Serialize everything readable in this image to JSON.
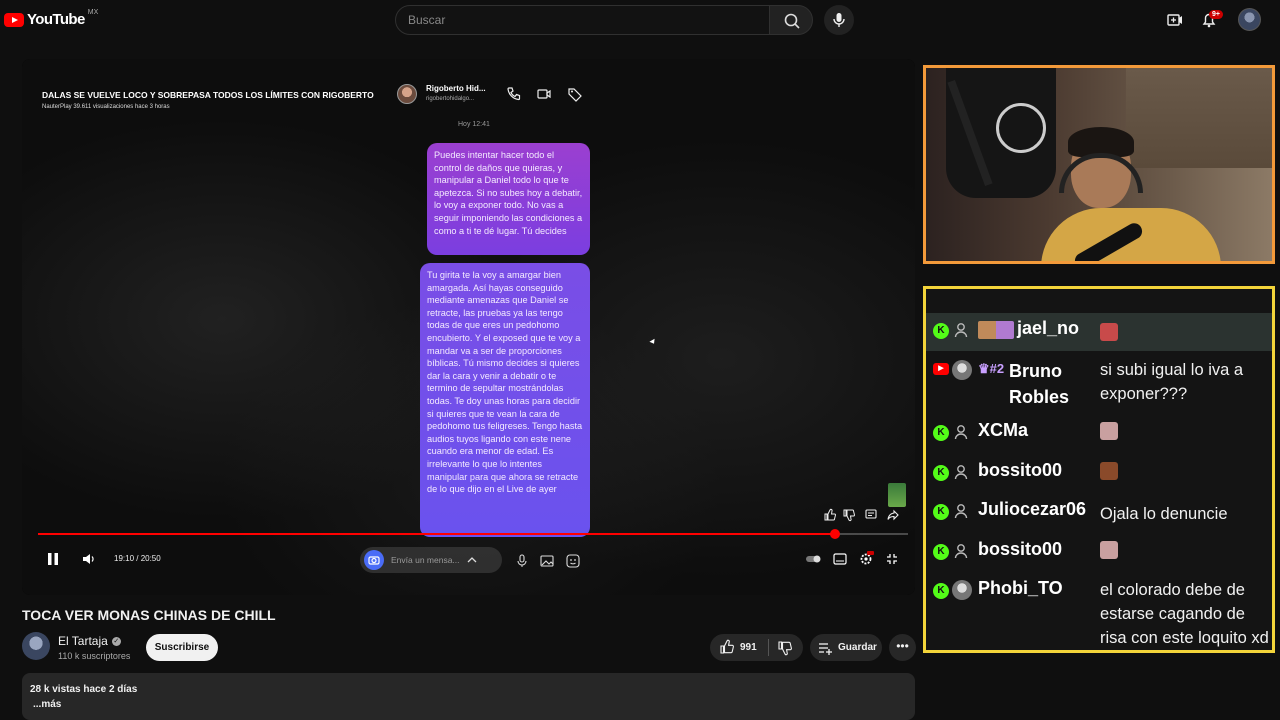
{
  "topbar": {
    "logo_word": "YouTube",
    "logo_country": "MX",
    "search_placeholder": "Buscar",
    "notif_badge": "9+",
    "icons": [
      "create-icon",
      "bell-icon",
      "search-icon",
      "mic-icon"
    ]
  },
  "video": {
    "title": "DALAS SE VUELVE LOCO Y SOBREPASA TODOS LOS LÍMITES CON RIGOBERTO",
    "meta": "NauterPlay  39.611 visualizaciones  hace 3 horas",
    "dm_name": "Rigoberto Hid...",
    "dm_handle": "rigobertohidalgo...",
    "dm_time": "Hoy 12:41",
    "bubble1": "Puedes intentar hacer todo el control de daños que quieras, y manipular a Daniel todo lo que te apetezca. Si no subes hoy a debatir, lo voy a exponer todo. No vas a seguir imponiendo las condiciones a como a ti te dé lugar. Tú decides",
    "bubble2": "Tu girita te la voy a amargar bien amargada. Así hayas conseguido mediante amenazas que Daniel se retracte, las pruebas ya las tengo todas de que eres un pedohomo encubierto. Y el exposed que te voy a mandar va a ser de proporciones bíblicas. Tú mismo decides si quieres dar la cara y venir a debatir o te termino de sepultar mostrándolas todas. Te doy unas horas para decidir si quieres que te vean la cara de pedohomo tus feligreses. Tengo hasta audios tuyos ligando con este nene cuando era menor de edad. Es irrelevante lo que lo intentes manipular para que ahora se retracte de lo que dijo en el Live de ayer",
    "message_placeholder": "Envía un mensa...",
    "time": "19:10 / 20:50",
    "progress": 0.916,
    "accent": "#ff0000"
  },
  "page": {
    "title": "TOCA VER MONAS CHINAS DE CHILL",
    "channel": "El Tartaja",
    "subs": "110 k suscriptores",
    "subscribe": "Suscribirse",
    "likes": "991",
    "save": "Guardar",
    "desc_stats": "28 k vistas  hace 2 días",
    "desc_more": "...más"
  },
  "chat": {
    "border_color": "#f3d43a",
    "messages": [
      {
        "user": "bossito00",
        "msg": "",
        "platform": "kick",
        "emote": "#8a4a2a"
      },
      {
        "user": "jael_no",
        "msg": "",
        "platform": "kick",
        "emote": "#c84a4a",
        "highlight": true
      },
      {
        "user": "Bruno Robles",
        "msg": "si subi igual lo iva a exponer???",
        "platform": "youtube",
        "badge": "#2"
      },
      {
        "user": "XCMa",
        "msg": "",
        "platform": "kick",
        "emote": "#c9a0a0"
      },
      {
        "user": "bossito00",
        "msg": "",
        "platform": "kick",
        "emote": "#8a4a2a"
      },
      {
        "user": "Juliocezar06",
        "msg": "Ojala lo denuncie",
        "platform": "kick"
      },
      {
        "user": "bossito00",
        "msg": "",
        "platform": "kick",
        "emote": "#c9a0a0"
      },
      {
        "user": "Phobi_TO",
        "msg": "el colorado debe de estarse cagando de risa con este loquito xd",
        "platform": "kick"
      }
    ]
  }
}
